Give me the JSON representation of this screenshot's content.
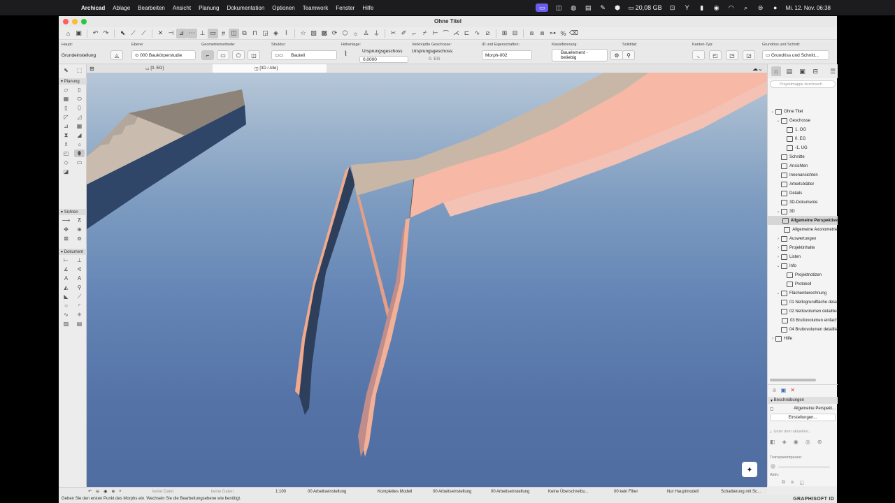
{
  "menubar": {
    "app_name": "Archicad",
    "items": [
      "Ablage",
      "Bearbeiten",
      "Ansicht",
      "Planung",
      "Dokumentation",
      "Optionen",
      "Teamwork",
      "Fenster",
      "Hilfe"
    ],
    "memory": "20,08 GB",
    "clock": "Mi. 12. Nov.  06:38"
  },
  "window": {
    "title": "Ohne Titel"
  },
  "infobox": {
    "haupt_label": "Haupt:",
    "haupt_value": "Grundeinstellung",
    "ebene_label": "Ebene:",
    "ebene_value": "000 Baukörperstudie",
    "geometrie_label": "Geometriemethode:",
    "struktur_label": "Struktur:",
    "struktur_value": "Bauteil",
    "hoehe_label": "Höhenlage:",
    "hoehe_ursprung": "Ursprungsgeschoss",
    "hoehe_value": "0,0000",
    "verkn_label": "Verknüpfte Geschosse:",
    "verkn_value": "Ursprungsgeschoss:",
    "verkn_eg": "0. EG",
    "id_label": "ID und Eigenschaften:",
    "id_value": "Morph-002",
    "klass_label": "Klassifizierung:",
    "klass_value_1": "Bauelement -",
    "klass_value_2": "beliebig",
    "solid_label": "Solidität:",
    "kanten_label": "Kanten-Typ:",
    "grund_label": "Grundriss und Schnitt:",
    "grund_value": "Grundriss und Schnitt..."
  },
  "tabs": [
    {
      "label": "[0. EG]"
    },
    {
      "label": "[3D / Alle]"
    }
  ],
  "toolbox": {
    "section_planung": "Planung",
    "section_sichten": "Sichten",
    "section_dokument": "Dokument"
  },
  "navigator": {
    "search_placeholder": "Projektmappe durchsuch",
    "tree": [
      {
        "label": "Ohne Titel",
        "level": 0,
        "chev": "⌄"
      },
      {
        "label": "Geschosse",
        "level": 1,
        "chev": "⌄"
      },
      {
        "label": "1. OG",
        "level": 2,
        "chev": ""
      },
      {
        "label": "0. EG",
        "level": 2,
        "chev": ""
      },
      {
        "label": "-1. UG",
        "level": 2,
        "chev": ""
      },
      {
        "label": "Schnitte",
        "level": 1,
        "chev": ""
      },
      {
        "label": "Ansichten",
        "level": 1,
        "chev": ""
      },
      {
        "label": "Innenansichten",
        "level": 1,
        "chev": ""
      },
      {
        "label": "Arbeitsblätter",
        "level": 1,
        "chev": ""
      },
      {
        "label": "Details",
        "level": 1,
        "chev": ""
      },
      {
        "label": "3D-Dokumente",
        "level": 1,
        "chev": ""
      },
      {
        "label": "3D",
        "level": 1,
        "chev": "⌄"
      },
      {
        "label": "Allgemeine Perspektive",
        "level": 2,
        "chev": "",
        "selected": true
      },
      {
        "label": "Allgemeine Axonometrie",
        "level": 2,
        "chev": ""
      },
      {
        "label": "Auswertungen",
        "level": 1,
        "chev": "›"
      },
      {
        "label": "Projektinhalte",
        "level": 1,
        "chev": "›"
      },
      {
        "label": "Listen",
        "level": 1,
        "chev": "›"
      },
      {
        "label": "Info",
        "level": 1,
        "chev": "⌄"
      },
      {
        "label": "Projektnotizen",
        "level": 2,
        "chev": ""
      },
      {
        "label": "Protokoll",
        "level": 2,
        "chev": ""
      },
      {
        "label": "Flächenberechnung",
        "level": 1,
        "chev": "⌄"
      },
      {
        "label": "01 Nettogrundfläche detailliert",
        "level": 2,
        "chev": ""
      },
      {
        "label": "02 Nettovolumen detailliert",
        "level": 2,
        "chev": ""
      },
      {
        "label": "03 Bruttovolumen einfach",
        "level": 2,
        "chev": ""
      },
      {
        "label": "04 Bruttovolumen detailliert",
        "level": 2,
        "chev": ""
      },
      {
        "label": "Hilfe",
        "level": 0,
        "chev": "›"
      }
    ],
    "desc_header": "Beschreibungen",
    "desc_view": "Allgemeine Perspekt...",
    "settings_label": "Einstellungen...",
    "under_label": "Unter dem aktuellen...",
    "transparent_label": "Transparentpause:",
    "active_label": "Aktiv:"
  },
  "bottombar": {
    "no_data_1": "keine Datei",
    "no_data_2": "keine Daten",
    "scale": "1:100",
    "arbeit_1": "00 Arbeitseinstellung",
    "modell": "Komplettes Modell",
    "arbeit_2": "00 Arbeitseinstellung",
    "arbeit_3": "00 Arbeitseinstellung",
    "ueberschr": "Keine Überschreibu...",
    "filter": "00 kein Filter",
    "hauptmodell": "Nur Hauptmodell",
    "schattierung": "Schattierung mit Sc..."
  },
  "status": {
    "message": "Geben Sie den ersten Punkt des Morphs ein. Wechseln Sie die Bearbeitungsebene wie benötigt.",
    "brand": "GRAPHISOFT ID"
  }
}
